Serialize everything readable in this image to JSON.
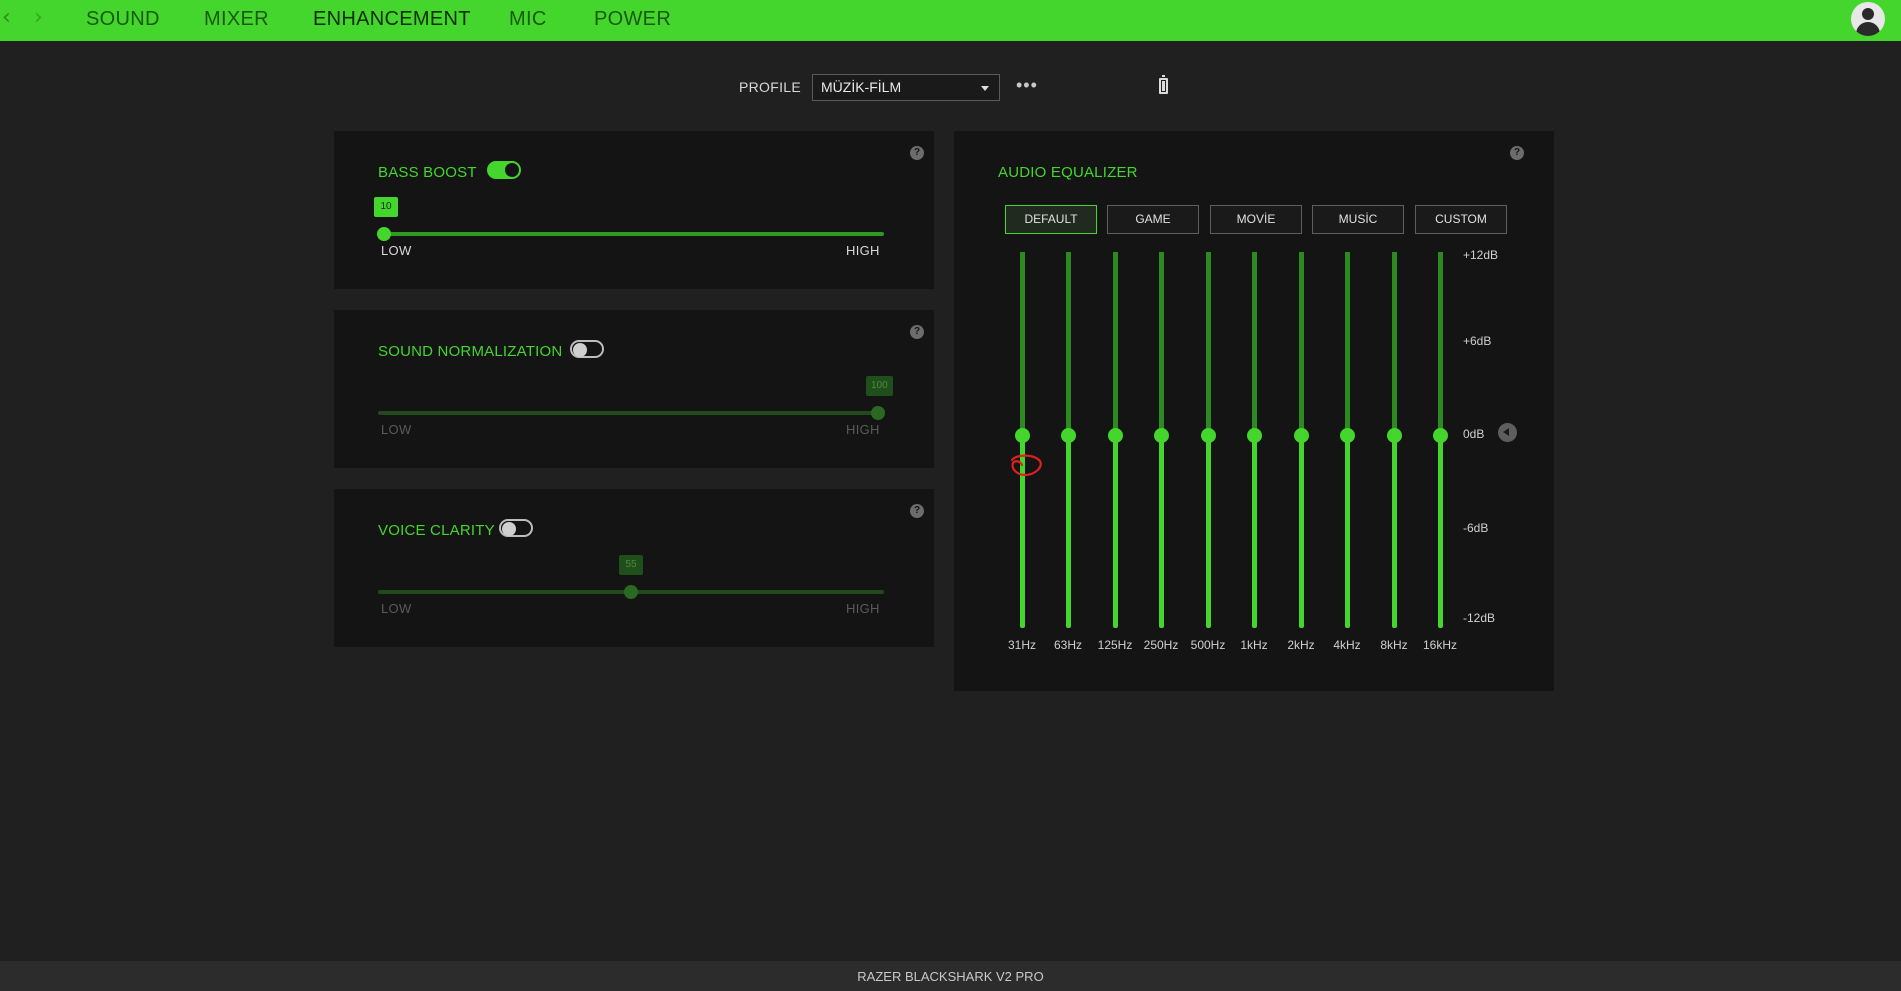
{
  "nav": {
    "back_icon": "chevron-left-icon",
    "forward_icon": "chevron-right-icon",
    "tabs": [
      {
        "label": "SOUND",
        "active": false
      },
      {
        "label": "MIXER",
        "active": false
      },
      {
        "label": "ENHANCEMENT",
        "active": true
      },
      {
        "label": "MIC",
        "active": false
      },
      {
        "label": "POWER",
        "active": false
      }
    ],
    "avatar_icon": "user-avatar-icon"
  },
  "profile": {
    "label": "PROFILE",
    "selected": "MÜZİK-FİLM",
    "more_icon": "more-dots-icon",
    "more_text": "•••",
    "battery_icon": "battery-icon"
  },
  "bass_boost": {
    "title": "BASS BOOST",
    "enabled": true,
    "value": "10",
    "value_fraction": 0.0,
    "low_label": "LOW",
    "high_label": "HIGH",
    "help": "?"
  },
  "sound_normalization": {
    "title": "SOUND NORMALIZATION",
    "enabled": false,
    "value": "100",
    "value_fraction": 1.0,
    "low_label": "LOW",
    "high_label": "HIGH",
    "help": "?"
  },
  "voice_clarity": {
    "title": "VOICE CLARITY",
    "enabled": false,
    "value": "55",
    "value_fraction": 0.5,
    "low_label": "LOW",
    "high_label": "HIGH",
    "help": "?"
  },
  "equalizer": {
    "title": "AUDIO EQUALIZER",
    "help": "?",
    "presets": [
      {
        "label": "DEFAULT",
        "active": true
      },
      {
        "label": "GAME",
        "active": false
      },
      {
        "label": "MOVİE",
        "active": false
      },
      {
        "label": "MUSİC",
        "active": false
      },
      {
        "label": "CUSTOM",
        "active": false
      }
    ],
    "bands": [
      {
        "freq": "31Hz",
        "gain_db": 0
      },
      {
        "freq": "63Hz",
        "gain_db": 0
      },
      {
        "freq": "125Hz",
        "gain_db": 0
      },
      {
        "freq": "250Hz",
        "gain_db": 0
      },
      {
        "freq": "500Hz",
        "gain_db": 0
      },
      {
        "freq": "1kHz",
        "gain_db": 0
      },
      {
        "freq": "2kHz",
        "gain_db": 0
      },
      {
        "freq": "4kHz",
        "gain_db": 0
      },
      {
        "freq": "8kHz",
        "gain_db": 0
      },
      {
        "freq": "16kHz",
        "gain_db": 0
      }
    ],
    "db_labels": {
      "p12": "+12dB",
      "p6": "+6dB",
      "zero": "0dB",
      "m6": "-6dB",
      "m12": "-12dB"
    },
    "reset_icon": "reset-arrow-icon"
  },
  "colors": {
    "accent": "#44d62c",
    "background": "#202020",
    "panel": "#141414",
    "annotation": "#e02020"
  },
  "footer": {
    "device_name": "RAZER BLACKSHARK V2 PRO"
  }
}
